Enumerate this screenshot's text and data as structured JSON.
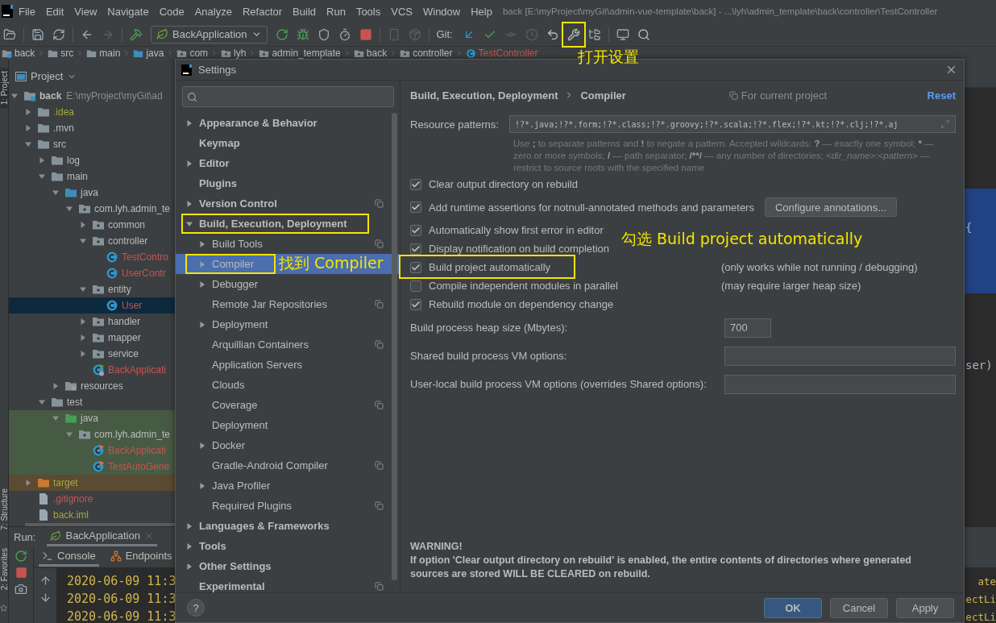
{
  "menu_bar": {
    "items": [
      "File",
      "Edit",
      "View",
      "Navigate",
      "Code",
      "Analyze",
      "Refactor",
      "Build",
      "Run",
      "Tools",
      "VCS",
      "Window",
      "Help"
    ],
    "title": "back [E:\\myProject\\myGit\\admin-vue-template\\back] - ...\\lyh\\admin_template\\back\\controller\\TestController"
  },
  "toolbar": {
    "run_configuration": "BackApplication",
    "git_label": "Git:"
  },
  "breadcrumbs": [
    {
      "label": "back",
      "kind": "module",
      "color": "#bbbbbb"
    },
    {
      "label": "src",
      "kind": "folder",
      "color": "#bbbbbb"
    },
    {
      "label": "main",
      "kind": "folder",
      "color": "#bbbbbb"
    },
    {
      "label": "java",
      "kind": "source-folder",
      "color": "#bbbbbb"
    },
    {
      "label": "com",
      "kind": "package",
      "color": "#bbbbbb"
    },
    {
      "label": "lyh",
      "kind": "package",
      "color": "#bbbbbb"
    },
    {
      "label": "admin_template",
      "kind": "package",
      "color": "#bbbbbb"
    },
    {
      "label": "back",
      "kind": "package",
      "color": "#bbbbbb"
    },
    {
      "label": "controller",
      "kind": "package",
      "color": "#bbbbbb"
    },
    {
      "label": "TestController",
      "kind": "class",
      "color": "#c75450"
    }
  ],
  "tool_strip": [
    {
      "label": "1: Project",
      "selected": true
    },
    {
      "label": "7: Structure",
      "selected": false
    },
    {
      "label": "2: Favorites",
      "selected": false
    }
  ],
  "project": {
    "title": "Project",
    "tree": [
      {
        "label": "back",
        "path": "E:\\myProject\\myGit\\ad",
        "kind": "module",
        "color": "#bbbbbb",
        "expanded": true,
        "selected": false,
        "in_test": false,
        "excluded": false,
        "children": [
          {
            "label": ".idea",
            "kind": "folder",
            "color": "#a6a63a",
            "expanded": false,
            "selected": false,
            "in_test": false,
            "excluded": false
          },
          {
            "label": ".mvn",
            "kind": "folder",
            "color": "#bbbbbb",
            "expanded": false,
            "selected": false,
            "in_test": false,
            "excluded": false
          },
          {
            "label": "src",
            "kind": "folder",
            "color": "#bbbbbb",
            "expanded": true,
            "selected": false,
            "in_test": false,
            "excluded": false,
            "children": [
              {
                "label": "log",
                "kind": "folder",
                "color": "#bbbbbb",
                "expanded": false,
                "selected": false,
                "in_test": false,
                "excluded": false
              },
              {
                "label": "main",
                "kind": "folder",
                "color": "#bbbbbb",
                "expanded": true,
                "selected": false,
                "in_test": false,
                "excluded": false,
                "children": [
                  {
                    "label": "java",
                    "kind": "source-folder",
                    "color": "#bbbbbb",
                    "expanded": true,
                    "selected": false,
                    "in_test": false,
                    "excluded": false,
                    "children": [
                      {
                        "label": "com.lyh.admin_te",
                        "kind": "package",
                        "color": "#bbbbbb",
                        "expanded": true,
                        "selected": false,
                        "in_test": false,
                        "excluded": false,
                        "children": [
                          {
                            "label": "common",
                            "kind": "package",
                            "color": "#bbbbbb",
                            "expanded": false,
                            "selected": false,
                            "in_test": false,
                            "excluded": false
                          },
                          {
                            "label": "controller",
                            "kind": "package",
                            "color": "#bbbbbb",
                            "expanded": true,
                            "selected": false,
                            "in_test": false,
                            "excluded": false,
                            "children": [
                              {
                                "label": "TestContro",
                                "kind": "class",
                                "color": "#c75450",
                                "expanded": false,
                                "selected": false,
                                "in_test": false,
                                "excluded": false
                              },
                              {
                                "label": "UserContr",
                                "kind": "class",
                                "color": "#c75450",
                                "expanded": false,
                                "selected": false,
                                "in_test": false,
                                "excluded": false
                              }
                            ]
                          },
                          {
                            "label": "entity",
                            "kind": "package",
                            "color": "#bbbbbb",
                            "expanded": true,
                            "selected": false,
                            "in_test": false,
                            "excluded": false,
                            "children": [
                              {
                                "label": "User",
                                "kind": "class",
                                "color": "#c75450",
                                "expanded": false,
                                "selected": true,
                                "in_test": false,
                                "excluded": false
                              }
                            ]
                          },
                          {
                            "label": "handler",
                            "kind": "package",
                            "color": "#bbbbbb",
                            "expanded": false,
                            "selected": false,
                            "in_test": false,
                            "excluded": false
                          },
                          {
                            "label": "mapper",
                            "kind": "package",
                            "color": "#bbbbbb",
                            "expanded": false,
                            "selected": false,
                            "in_test": false,
                            "excluded": false
                          },
                          {
                            "label": "service",
                            "kind": "package",
                            "color": "#bbbbbb",
                            "expanded": false,
                            "selected": false,
                            "in_test": false,
                            "excluded": false
                          },
                          {
                            "label": "BackApplicati",
                            "kind": "app-class",
                            "color": "#c75450",
                            "expanded": false,
                            "selected": false,
                            "in_test": false,
                            "excluded": false
                          }
                        ]
                      }
                    ]
                  },
                  {
                    "label": "resources",
                    "kind": "resources-folder",
                    "color": "#bbbbbb",
                    "expanded": false,
                    "selected": false,
                    "in_test": false,
                    "excluded": false
                  }
                ]
              },
              {
                "label": "test",
                "kind": "folder",
                "color": "#bbbbbb",
                "expanded": true,
                "selected": false,
                "in_test": false,
                "excluded": false,
                "children": [
                  {
                    "label": "java",
                    "kind": "test-folder",
                    "color": "#bbbbbb",
                    "expanded": true,
                    "selected": false,
                    "in_test": true,
                    "excluded": false,
                    "children": [
                      {
                        "label": "com.lyh.admin_te",
                        "kind": "package",
                        "color": "#bbbbbb",
                        "expanded": true,
                        "selected": false,
                        "in_test": true,
                        "excluded": false,
                        "children": [
                          {
                            "label": "BackApplicati",
                            "kind": "test-class",
                            "color": "#c75450",
                            "expanded": false,
                            "selected": false,
                            "in_test": true,
                            "excluded": false
                          },
                          {
                            "label": "TestAutoGene",
                            "kind": "test-class",
                            "color": "#c75450",
                            "expanded": false,
                            "selected": false,
                            "in_test": true,
                            "excluded": false
                          }
                        ]
                      }
                    ]
                  }
                ]
              }
            ]
          },
          {
            "label": "target",
            "kind": "excluded-folder",
            "color": "#a6a63a",
            "expanded": false,
            "selected": false,
            "in_test": false,
            "excluded": true
          },
          {
            "label": ".gitignore",
            "kind": "file",
            "color": "#c75450",
            "expanded": false,
            "selected": false,
            "in_test": false,
            "excluded": false
          },
          {
            "label": "back.iml",
            "kind": "file",
            "color": "#a6a63a",
            "expanded": false,
            "selected": false,
            "in_test": false,
            "excluded": false
          }
        ]
      }
    ]
  },
  "editor": {
    "fragments": [
      "{",
      "ser)"
    ]
  },
  "run": {
    "label": "Run:",
    "tabs": [
      {
        "label": "BackApplication",
        "selected": true
      }
    ],
    "console_tabs": [
      {
        "label": "Console",
        "selected": true
      },
      {
        "label": "Endpoints",
        "selected": false
      }
    ],
    "lines": [
      {
        "start": "2020-06-09 11:3",
        "end": "ate"
      },
      {
        "start": "2020-06-09 11:3",
        "end": "ectLi"
      },
      {
        "start": "2020-06-09 11:3",
        "end": "ectLi"
      }
    ]
  },
  "settings": {
    "title": "Settings",
    "nav": [
      {
        "label": "Appearance & Behavior",
        "kind": "group",
        "expanded": false,
        "selected": false,
        "project_level": false,
        "framed": false
      },
      {
        "label": "Keymap",
        "kind": "leaf",
        "expanded": false,
        "selected": false,
        "project_level": false,
        "framed": false
      },
      {
        "label": "Editor",
        "kind": "group",
        "expanded": false,
        "selected": false,
        "project_level": false,
        "framed": false
      },
      {
        "label": "Plugins",
        "kind": "leaf",
        "expanded": false,
        "selected": false,
        "project_level": false,
        "framed": false
      },
      {
        "label": "Version Control",
        "kind": "group",
        "expanded": false,
        "selected": false,
        "project_level": true,
        "framed": false
      },
      {
        "label": "Build, Execution, Deployment",
        "kind": "group",
        "expanded": true,
        "selected": false,
        "project_level": false,
        "framed": true,
        "children": [
          {
            "label": "Build Tools",
            "kind": "group",
            "expanded": false,
            "selected": false,
            "project_level": true,
            "framed": false
          },
          {
            "label": "Compiler",
            "kind": "group",
            "expanded": false,
            "selected": true,
            "project_level": false,
            "framed": true
          },
          {
            "label": "Debugger",
            "kind": "group",
            "expanded": false,
            "selected": false,
            "project_level": false,
            "framed": false
          },
          {
            "label": "Remote Jar Repositories",
            "kind": "leaf",
            "expanded": false,
            "selected": false,
            "project_level": true,
            "framed": false
          },
          {
            "label": "Deployment",
            "kind": "group",
            "expanded": false,
            "selected": false,
            "project_level": false,
            "framed": false
          },
          {
            "label": "Arquillian Containers",
            "kind": "leaf",
            "expanded": false,
            "selected": false,
            "project_level": true,
            "framed": false
          },
          {
            "label": "Application Servers",
            "kind": "leaf",
            "expanded": false,
            "selected": false,
            "project_level": false,
            "framed": false
          },
          {
            "label": "Clouds",
            "kind": "leaf",
            "expanded": false,
            "selected": false,
            "project_level": false,
            "framed": false
          },
          {
            "label": "Coverage",
            "kind": "leaf",
            "expanded": false,
            "selected": false,
            "project_level": true,
            "framed": false
          },
          {
            "label": "Deployment",
            "kind": "leaf",
            "expanded": false,
            "selected": false,
            "project_level": false,
            "framed": false
          },
          {
            "label": "Docker",
            "kind": "group",
            "expanded": false,
            "selected": false,
            "project_level": false,
            "framed": false
          },
          {
            "label": "Gradle-Android Compiler",
            "kind": "leaf",
            "expanded": false,
            "selected": false,
            "project_level": true,
            "framed": false
          },
          {
            "label": "Java Profiler",
            "kind": "group",
            "expanded": false,
            "selected": false,
            "project_level": false,
            "framed": false
          },
          {
            "label": "Required Plugins",
            "kind": "leaf",
            "expanded": false,
            "selected": false,
            "project_level": true,
            "framed": false
          }
        ]
      },
      {
        "label": "Languages & Frameworks",
        "kind": "group",
        "expanded": false,
        "selected": false,
        "project_level": false,
        "framed": false
      },
      {
        "label": "Tools",
        "kind": "group",
        "expanded": false,
        "selected": false,
        "project_level": false,
        "framed": false
      },
      {
        "label": "Other Settings",
        "kind": "group",
        "expanded": false,
        "selected": false,
        "project_level": false,
        "framed": false
      },
      {
        "label": "Experimental",
        "kind": "leaf",
        "expanded": false,
        "selected": false,
        "project_level": true,
        "framed": false
      }
    ],
    "breadcrumb": [
      "Build, Execution, Deployment",
      "Compiler"
    ],
    "scope_note": "For current project",
    "reset": "Reset",
    "resource_patterns": {
      "label": "Resource patterns:",
      "value": "!?*.java;!?*.form;!?*.class;!?*.groovy;!?*.scala;!?*.flex;!?*.kt;!?*.clj;!?*.aj"
    },
    "hint": [
      {
        "text": "Use ",
        "kind": "plain"
      },
      {
        "text": ";",
        "kind": "bold"
      },
      {
        "text": " to separate patterns and ",
        "kind": "plain"
      },
      {
        "text": "!",
        "kind": "bold"
      },
      {
        "text": " to negate a pattern. Accepted wildcards: ",
        "kind": "plain"
      },
      {
        "text": "?",
        "kind": "bold"
      },
      {
        "text": " — exactly one symbol; ",
        "kind": "plain"
      },
      {
        "text": "*",
        "kind": "bold"
      },
      {
        "text": " — zero or more symbols; ",
        "kind": "plain"
      },
      {
        "text": "/",
        "kind": "bold"
      },
      {
        "text": " — path separator; ",
        "kind": "plain"
      },
      {
        "text": "/**/",
        "kind": "bold"
      },
      {
        "text": " — any number of directories; ",
        "kind": "plain"
      },
      {
        "text": "<dir_name>",
        "kind": "italic"
      },
      {
        "text": ":",
        "kind": "plain"
      },
      {
        "text": "<pattern>",
        "kind": "italic"
      },
      {
        "text": " — restrict to source roots with the specified name",
        "kind": "plain"
      }
    ],
    "options": [
      {
        "label": "Clear output directory on rebuild",
        "checked": true,
        "framed": false
      },
      {
        "label": "Add runtime assertions for notnull-annotated methods and parameters",
        "checked": true,
        "framed": false,
        "button": "Configure annotations..."
      },
      {
        "label": "Automatically show first error in editor",
        "checked": true,
        "framed": false
      },
      {
        "label": "Display notification on build completion",
        "checked": true,
        "framed": false
      },
      {
        "label": "Build project automatically",
        "checked": true,
        "framed": true,
        "note": "(only works while not running / debugging)"
      },
      {
        "label": "Compile independent modules in parallel",
        "checked": false,
        "framed": false,
        "note": "(may require larger heap size)"
      },
      {
        "label": "Rebuild module on dependency change",
        "checked": true,
        "framed": false
      }
    ],
    "fields": [
      {
        "label": "Build process heap size (Mbytes):",
        "kind": "short",
        "value": "700"
      },
      {
        "label": "Shared build process VM options:",
        "kind": "long"
      },
      {
        "label": "User-local build process VM options (overrides Shared options):",
        "kind": "long"
      }
    ],
    "warning": {
      "title": "WARNING!",
      "text": "If option 'Clear output directory on rebuild' is enabled, the entire contents of directories where generated sources are stored WILL BE CLEARED on rebuild."
    },
    "help": "?",
    "buttons": [
      {
        "label": "OK",
        "kind": "default"
      },
      {
        "label": "Cancel",
        "kind": "normal"
      },
      {
        "label": "Apply",
        "kind": "normal"
      }
    ]
  },
  "annotations": [
    {
      "text": "打开设置"
    },
    {
      "text": "找到 Compiler"
    },
    {
      "text": "勾选 Build project automatically"
    }
  ]
}
